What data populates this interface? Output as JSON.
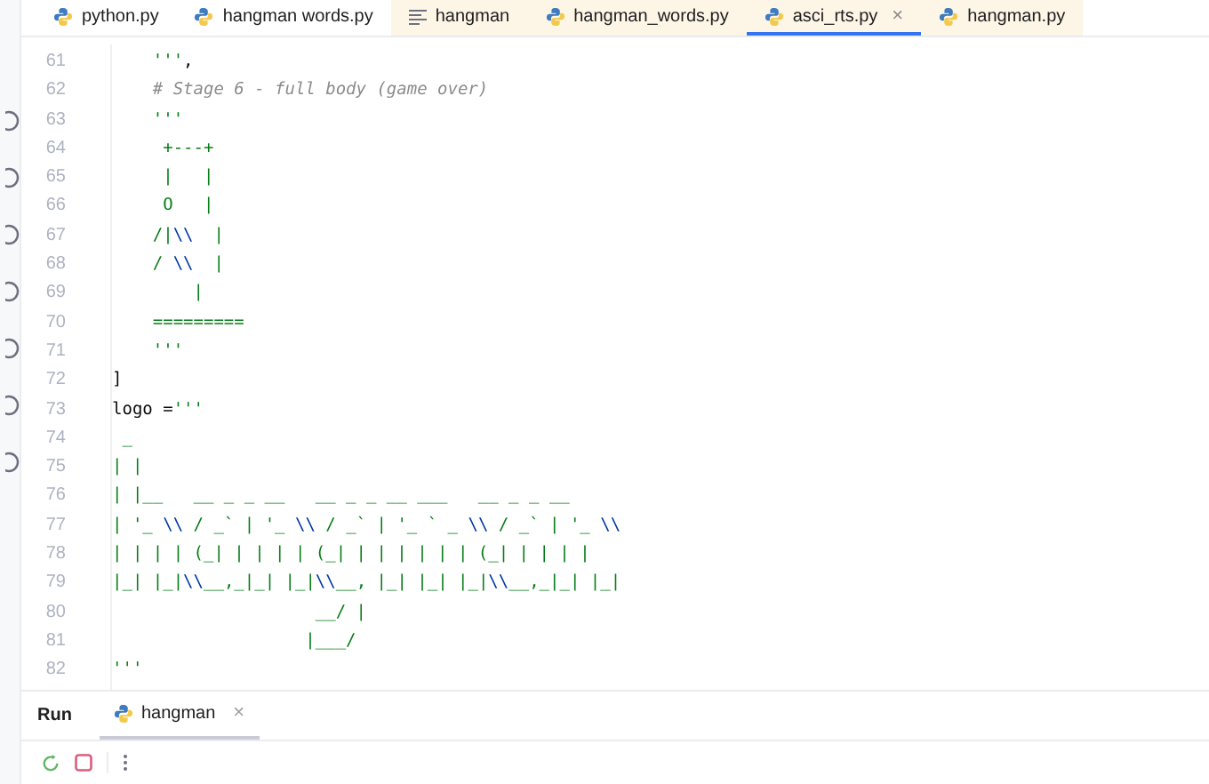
{
  "tabs": [
    {
      "label": "python.py",
      "kind": "python",
      "selected": false,
      "highlighted": false
    },
    {
      "label": "hangman words.py",
      "kind": "python",
      "selected": false,
      "highlighted": false
    },
    {
      "label": "hangman",
      "kind": "text",
      "selected": false,
      "highlighted": true
    },
    {
      "label": "hangman_words.py",
      "kind": "python",
      "selected": false,
      "highlighted": true
    },
    {
      "label": "asci_rts.py",
      "kind": "python",
      "selected": true,
      "highlighted": true,
      "close": "×"
    },
    {
      "label": "hangman.py",
      "kind": "python",
      "selected": false,
      "highlighted": true
    }
  ],
  "editor": {
    "lines": [
      {
        "number": "61",
        "segments": [
          {
            "kind": "string",
            "text": "    '''"
          },
          {
            "kind": "code",
            "text": ","
          }
        ]
      },
      {
        "number": "62",
        "segments": [
          {
            "kind": "comment",
            "text": "    # Stage 6 - full body (game over)"
          }
        ]
      },
      {
        "number": "63",
        "segments": [
          {
            "kind": "string",
            "text": "    '''"
          }
        ]
      },
      {
        "number": "64",
        "segments": [
          {
            "kind": "string",
            "text": "     +---+"
          }
        ]
      },
      {
        "number": "65",
        "segments": [
          {
            "kind": "string",
            "text": "     |   |"
          }
        ]
      },
      {
        "number": "66",
        "segments": [
          {
            "kind": "string",
            "text": "     O   |"
          }
        ]
      },
      {
        "number": "67",
        "segments": [
          {
            "kind": "string",
            "text": "    /|"
          },
          {
            "kind": "escape",
            "text": "\\\\"
          },
          {
            "kind": "string",
            "text": "  |"
          }
        ]
      },
      {
        "number": "68",
        "segments": [
          {
            "kind": "string",
            "text": "    / "
          },
          {
            "kind": "escape",
            "text": "\\\\"
          },
          {
            "kind": "string",
            "text": "  |"
          }
        ]
      },
      {
        "number": "69",
        "segments": [
          {
            "kind": "string",
            "text": "        |"
          }
        ]
      },
      {
        "number": "70",
        "segments": [
          {
            "kind": "string",
            "text": "    ========="
          }
        ]
      },
      {
        "number": "71",
        "segments": [
          {
            "kind": "string",
            "text": "    '''"
          }
        ]
      },
      {
        "number": "72",
        "segments": [
          {
            "kind": "code",
            "text": "]"
          }
        ]
      },
      {
        "number": "73",
        "segments": [
          {
            "kind": "code",
            "text": "logo ="
          },
          {
            "kind": "string",
            "text": "'''"
          }
        ]
      },
      {
        "number": "74",
        "segments": [
          {
            "kind": "string",
            "text": " _"
          }
        ]
      },
      {
        "number": "75",
        "segments": [
          {
            "kind": "string",
            "text": "| |"
          }
        ]
      },
      {
        "number": "76",
        "segments": [
          {
            "kind": "string",
            "text": "| |__   __ _ _ __   __ _ _ __ ___   __ _ _ __"
          }
        ]
      },
      {
        "number": "77",
        "segments": [
          {
            "kind": "string",
            "text": "| '_ "
          },
          {
            "kind": "escape",
            "text": "\\\\"
          },
          {
            "kind": "string",
            "text": " / _` | '_ "
          },
          {
            "kind": "escape",
            "text": "\\\\"
          },
          {
            "kind": "string",
            "text": " / _` | '_ ` _ "
          },
          {
            "kind": "escape",
            "text": "\\\\"
          },
          {
            "kind": "string",
            "text": " / _` | '_ "
          },
          {
            "kind": "escape",
            "text": "\\\\"
          }
        ]
      },
      {
        "number": "78",
        "segments": [
          {
            "kind": "string",
            "text": "| | | | (_| | | | | (_| | | | | | | (_| | | | |"
          }
        ]
      },
      {
        "number": "79",
        "segments": [
          {
            "kind": "string",
            "text": "|_| |_|"
          },
          {
            "kind": "escape",
            "text": "\\\\"
          },
          {
            "kind": "string",
            "text": "__,_|_| |_|"
          },
          {
            "kind": "escape",
            "text": "\\\\"
          },
          {
            "kind": "string",
            "text": "__, |_| |_| |_|"
          },
          {
            "kind": "escape",
            "text": "\\\\"
          },
          {
            "kind": "string",
            "text": "__,_|_| |_|"
          }
        ]
      },
      {
        "number": "80",
        "segments": [
          {
            "kind": "string",
            "text": "                    __/ |"
          }
        ]
      },
      {
        "number": "81",
        "segments": [
          {
            "kind": "string",
            "text": "                   |___/"
          }
        ]
      },
      {
        "number": "82",
        "segments": [
          {
            "kind": "string",
            "text": "'''"
          }
        ]
      }
    ]
  },
  "run_panel": {
    "title": "Run",
    "tab": {
      "label": "hangman",
      "close": "×",
      "selected": true
    }
  }
}
